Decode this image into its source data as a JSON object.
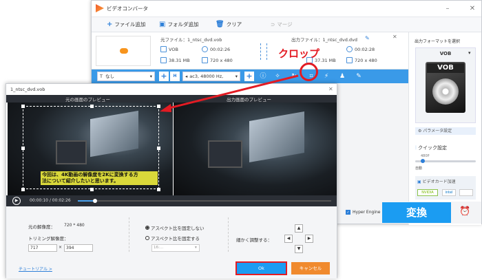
{
  "app": {
    "title": "ビデオコンバータ"
  },
  "toolbar": {
    "add_file": "ファイル追加",
    "add_folder": "フォルダ追加",
    "clear": "クリア",
    "merge": "マージ"
  },
  "file": {
    "source_label": "元ファイル：1_ntsc_dvd.vob",
    "output_label": "出力ファイル：1_ntsc_dvd.dvd",
    "format": "VOB",
    "duration": "00:02:26",
    "size": "38.31 MB",
    "resolution": "720 x 480",
    "out_duration": "00:02:28",
    "out_size": "37.31 MB",
    "out_resolution": "720 x 480"
  },
  "options": {
    "subtitle": "なし",
    "audio": "ac3, 48000 Hz,"
  },
  "annotation": {
    "crop": "クロップ"
  },
  "right": {
    "select_format": "出力フォーマットを選択",
    "format": "VOB",
    "param": "パラメータ設定",
    "quick": "クイック設定",
    "quality": "480P",
    "auto": "自動",
    "gpu": "ビデオカード加速",
    "nvidia": "NVIDIA",
    "intel": "intel"
  },
  "bottom": {
    "hyper": "Hyper Engine",
    "convert": "変換"
  },
  "dialog": {
    "title": "1_ntsc_dvd.vob",
    "orig_preview": "元の画面のプレビュー",
    "out_preview": "出力画面のプレビュー",
    "subtitle_line1": "今回は、4K動画の解像度を2Kに変換する方",
    "subtitle_line2": "法について紹介したいと思います。",
    "time": "00:00:10 / 00:02:26",
    "orig_res_label": "元の解像度：",
    "orig_res": "720 * 480",
    "trim_res_label": "トリミング解像度：",
    "trim_w": "717",
    "trim_h": "394",
    "aspect_keep": "アスペクト比を固定しない",
    "aspect_fixed": "アスペクト比を固定する",
    "aspect_select": "16:...",
    "fine_adjust": "細かく調整する：",
    "tutorial": "チュートリアル >",
    "ok": "Ok",
    "cancel": "キャンセル"
  },
  "colors": {
    "accent": "#2d7fd8",
    "convert": "#1b9cf2",
    "cancel": "#f08a2e",
    "annotation": "#e31b23"
  }
}
